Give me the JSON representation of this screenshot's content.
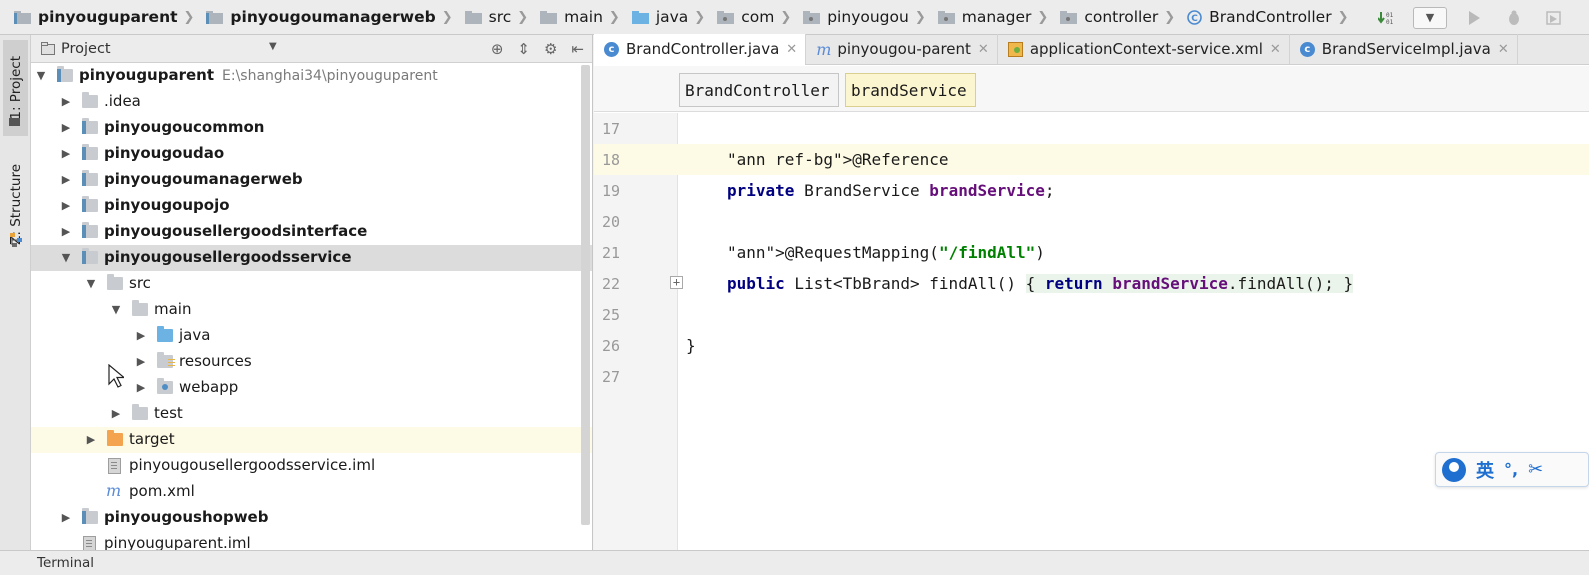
{
  "breadcrumbs": [
    {
      "label": "pinyouguparent",
      "bold": true,
      "icon": "module-folder-icon"
    },
    {
      "label": "pinyougoumanagerweb",
      "bold": true,
      "icon": "module-folder-icon"
    },
    {
      "label": "src",
      "bold": false,
      "icon": "folder-icon"
    },
    {
      "label": "main",
      "bold": false,
      "icon": "folder-icon"
    },
    {
      "label": "java",
      "bold": false,
      "icon": "source-folder-icon"
    },
    {
      "label": "com",
      "bold": false,
      "icon": "package-icon"
    },
    {
      "label": "pinyougou",
      "bold": false,
      "icon": "package-icon"
    },
    {
      "label": "manager",
      "bold": false,
      "icon": "package-icon"
    },
    {
      "label": "controller",
      "bold": false,
      "icon": "package-icon"
    },
    {
      "label": "BrandController",
      "bold": false,
      "icon": "class-icon"
    }
  ],
  "left_strip": {
    "project_tab": "1: Project",
    "structure_tab": "Z: Structure"
  },
  "project_panel": {
    "title": "Project",
    "tree": [
      {
        "label": "pinyouguparent",
        "path": "E:\\shanghai34\\pinyouguparent",
        "bold": true,
        "arrow": "expanded",
        "icon": "module"
      },
      {
        "label": ".idea",
        "bold": false,
        "arrow": "collapsed",
        "icon": "folder"
      },
      {
        "label": "pinyougoucommon",
        "bold": true,
        "arrow": "collapsed",
        "icon": "module"
      },
      {
        "label": "pinyougoudao",
        "bold": true,
        "arrow": "collapsed",
        "icon": "module"
      },
      {
        "label": "pinyougoumanagerweb",
        "bold": true,
        "arrow": "collapsed",
        "icon": "module"
      },
      {
        "label": "pinyougoupojo",
        "bold": true,
        "arrow": "collapsed",
        "icon": "module"
      },
      {
        "label": "pinyougousellergoodsinterface",
        "bold": true,
        "arrow": "collapsed",
        "icon": "module"
      },
      {
        "label": "pinyougousellergoodsservice",
        "bold": true,
        "arrow": "expanded",
        "icon": "module",
        "selected": true
      },
      {
        "label": "src",
        "bold": false,
        "arrow": "expanded",
        "icon": "folder"
      },
      {
        "label": "main",
        "bold": false,
        "arrow": "expanded",
        "icon": "folder"
      },
      {
        "label": "java",
        "bold": false,
        "arrow": "collapsed",
        "icon": "source"
      },
      {
        "label": "resources",
        "bold": false,
        "arrow": "collapsed",
        "icon": "resources"
      },
      {
        "label": "webapp",
        "bold": false,
        "arrow": "collapsed",
        "icon": "web"
      },
      {
        "label": "test",
        "bold": false,
        "arrow": "collapsed",
        "icon": "folder"
      },
      {
        "label": "target",
        "bold": false,
        "arrow": "collapsed",
        "icon": "excluded",
        "highlight": true
      },
      {
        "label": "pinyougousellergoodsservice.iml",
        "bold": false,
        "arrow": "",
        "icon": "file"
      },
      {
        "label": "pom.xml",
        "bold": false,
        "arrow": "",
        "icon": "maven"
      },
      {
        "label": "pinyougoushopweb",
        "bold": true,
        "arrow": "collapsed",
        "icon": "module"
      },
      {
        "label": "pinyouguparent.iml",
        "bold": false,
        "arrow": "",
        "icon": "file"
      }
    ]
  },
  "editor": {
    "tabs": [
      {
        "label": "BrandController.java",
        "icon": "class",
        "active": true
      },
      {
        "label": "pinyougou-parent",
        "icon": "maven",
        "active": false
      },
      {
        "label": "applicationContext-service.xml",
        "icon": "xml",
        "active": false
      },
      {
        "label": "BrandServiceImpl.java",
        "icon": "class",
        "active": false
      }
    ],
    "structure": [
      "BrandController",
      "brandService"
    ],
    "lines": [
      {
        "num": "17",
        "text": ""
      },
      {
        "num": "18",
        "text": "@Reference"
      },
      {
        "num": "19",
        "text": "private BrandService brandService;"
      },
      {
        "num": "20",
        "text": ""
      },
      {
        "num": "21",
        "text": "@RequestMapping(\"/findAll\")"
      },
      {
        "num": "22",
        "text": "public List<TbBrand> findAll() { return brandService.findAll(); }"
      },
      {
        "num": "25",
        "text": ""
      },
      {
        "num": "26",
        "text": "}"
      },
      {
        "num": "27",
        "text": ""
      }
    ]
  },
  "ime": {
    "lang": "英",
    "punct": "°,",
    "extra": "✂"
  },
  "bottom": {
    "terminal": "Terminal"
  },
  "colors": {
    "annotation": "#808000",
    "keyword": "#000080",
    "field": "#660e7a",
    "string": "#008000",
    "selection": "#dcdcdc",
    "caret_line": "#fdfbe6"
  }
}
